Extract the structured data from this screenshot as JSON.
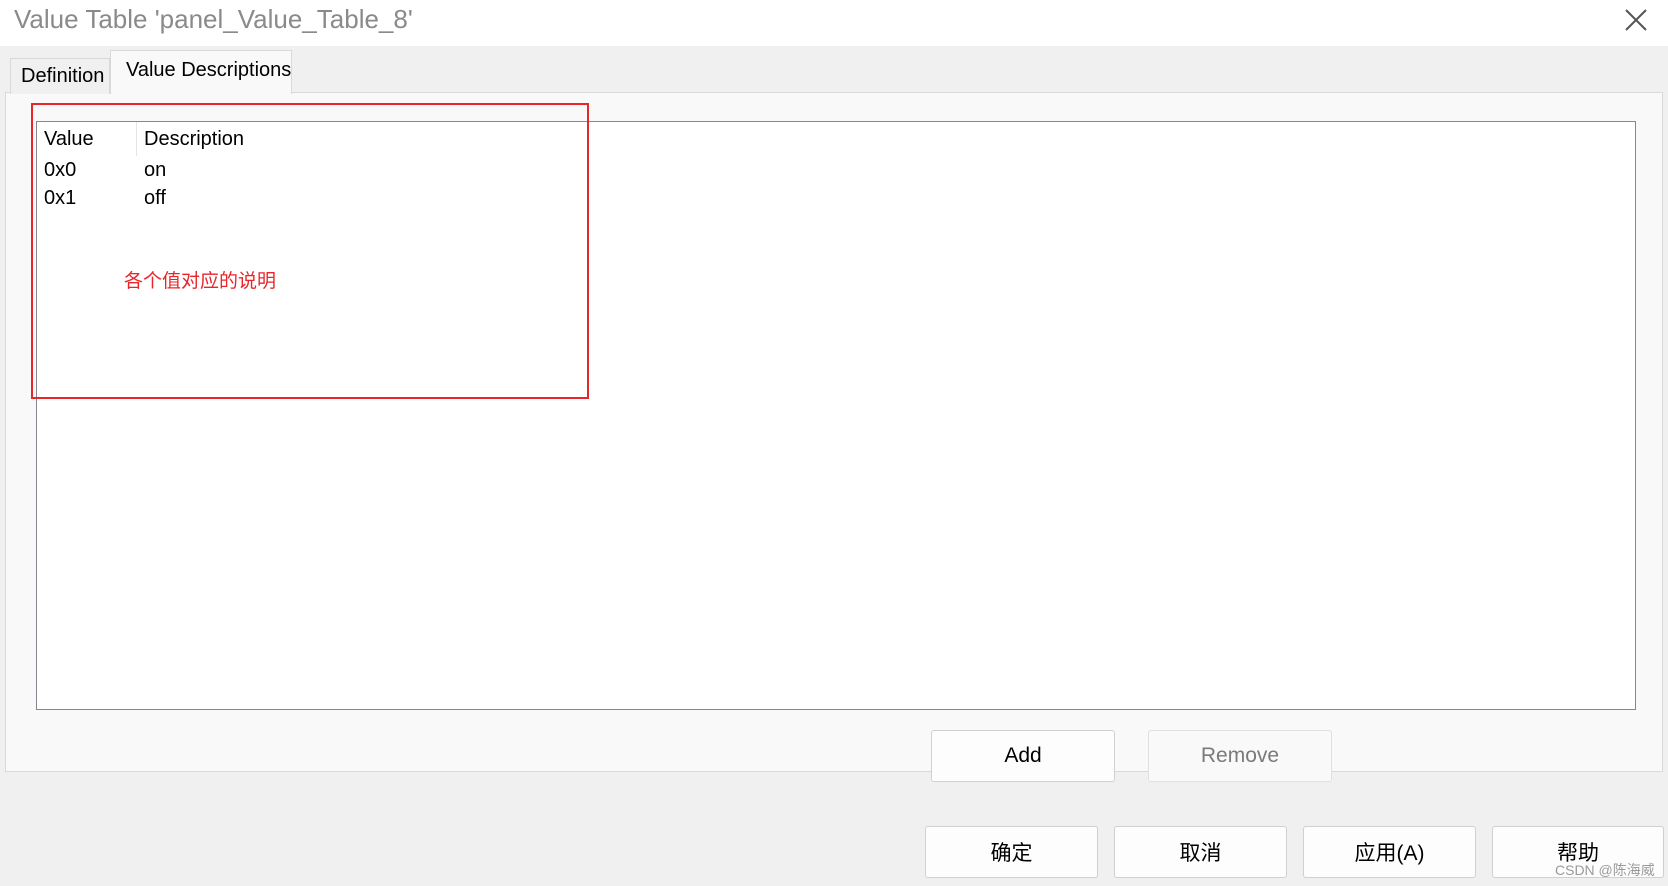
{
  "window": {
    "title": "Value Table 'panel_Value_Table_8'"
  },
  "tabs": [
    {
      "label": "Definition",
      "active": false
    },
    {
      "label": "Value Descriptions",
      "active": true
    }
  ],
  "table": {
    "columns": [
      "Value",
      "Description"
    ],
    "rows": [
      {
        "value": "0x0",
        "description": "on"
      },
      {
        "value": "0x1",
        "description": "off"
      }
    ]
  },
  "annotation": {
    "text": "各个值对应的说明",
    "color": "#e8262a"
  },
  "actions": {
    "add_label": "Add",
    "remove_label": "Remove",
    "remove_disabled": true
  },
  "dialog_buttons": {
    "ok_label": "确定",
    "cancel_label": "取消",
    "apply_label": "应用(A)",
    "help_label": "帮助"
  },
  "watermark": "CSDN @陈海威"
}
